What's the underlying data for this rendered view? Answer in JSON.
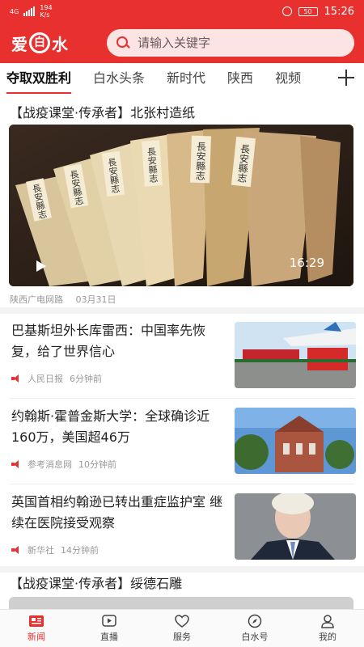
{
  "status_bar": {
    "network": "4G",
    "net_speed_value": "194",
    "net_speed_unit": "K/s",
    "battery": "50",
    "time": "15:26"
  },
  "header": {
    "logo_text_left": "爱",
    "logo_text_circle": "白",
    "logo_text_right": "水",
    "search_placeholder": "请输入关键字"
  },
  "tabs": [
    {
      "label": "夺取双胜利",
      "active": true
    },
    {
      "label": "白水头条"
    },
    {
      "label": "新时代"
    },
    {
      "label": "陕西"
    },
    {
      "label": "视频"
    }
  ],
  "video": {
    "title": "【战疫课堂·传承者】北张村造纸",
    "duration": "16:29",
    "source": "陕西广电网路",
    "date": "03月31日",
    "book_labels": [
      "長安縣志",
      "長安縣志",
      "長安縣志",
      "長安縣志",
      "長安縣志",
      "長安縣志"
    ]
  },
  "news": [
    {
      "title": "巴基斯坦外长库雷西：中国率先恢复，给了世界信心",
      "source": "人民日报",
      "time": "6分钟前"
    },
    {
      "title": "约翰斯·霍普金斯大学：全球确诊近160万，美国超46万",
      "source": "参考消息网",
      "time": "10分钟前"
    },
    {
      "title": "英国首相约翰逊已转出重症监护室 继续在医院接受观察",
      "source": "新华社",
      "time": "14分钟前"
    }
  ],
  "tail": {
    "title": "【战疫课堂·传承者】绥德石雕"
  },
  "bottom_nav": [
    {
      "label": "新闻",
      "icon": "news-icon",
      "active": true
    },
    {
      "label": "直播",
      "icon": "live-icon"
    },
    {
      "label": "服务",
      "icon": "service-icon"
    },
    {
      "label": "白水号",
      "icon": "compass-icon"
    },
    {
      "label": "我的",
      "icon": "user-icon"
    }
  ],
  "colors": {
    "brand": "#e8302f"
  }
}
